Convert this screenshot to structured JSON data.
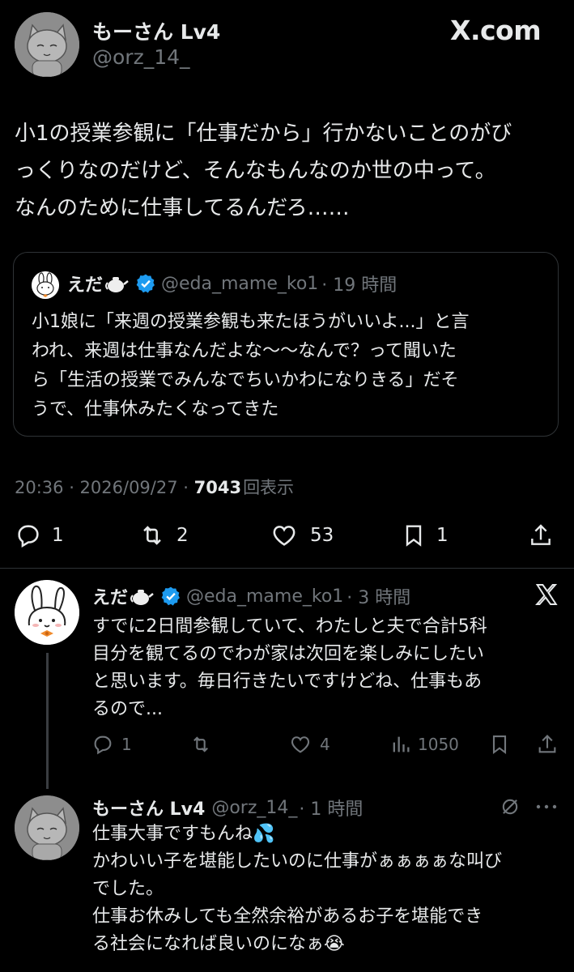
{
  "brand": {
    "logo_text": "X.com"
  },
  "main_tweet": {
    "display_name": "もーさん Lv4",
    "handle": "@orz_14_",
    "body_lines": [
      "小1の授業参観に「仕事だから」行かないことのがび",
      "っくりなのだけど、そんなもんなのか世の中って。",
      "なんのために仕事してるんだろ……"
    ],
    "timestamp": "20:36 · 2026/09/27 · ",
    "views_count": "7043",
    "views_label": "回表示",
    "actions": {
      "replies": "1",
      "retweets": "2",
      "likes": "53",
      "bookmarks": "1"
    }
  },
  "quoted_tweet": {
    "display_name": "えだ",
    "handle": "@eda_mame_ko1",
    "time": "· 19 時間",
    "body_lines": [
      "小1娘に「来週の授業参観も来たほうがいいよ...」と言",
      "われ、来週は仕事なんだよな〜〜なんで？って聞いた",
      "ら「生活の授業でみんなでちいかわになりきる」だそ",
      "うで、仕事休みたくなってきた"
    ]
  },
  "reply_1": {
    "display_name": "えだ",
    "handle": "@eda_mame_ko1",
    "time": "· 3 時間",
    "body_lines": [
      "すでに2日間参観していて、わたしと夫で合計5科",
      "目分を観てるのでわが家は次回を楽しみにしたい",
      "と思います。毎日行きたいですけどね、仕事もあ",
      "るので..."
    ],
    "actions": {
      "replies": "1",
      "retweets": "",
      "likes": "4",
      "views": "1050"
    }
  },
  "reply_2": {
    "display_name": "もーさん Lv4",
    "handle": "@orz_14_",
    "time": "· 1 時間",
    "body_lines": [
      "仕事大事ですもんね💦",
      "かわいい子を堪能したいのに仕事がぁぁぁぁな叫び",
      "でした。",
      "仕事お休みしても全然余裕があるお子を堪能でき",
      "る社会になれば良いのになぁ😭"
    ]
  },
  "colors": {
    "background": "#000000",
    "text": "#e7e9ea",
    "secondary": "#71767b",
    "verified": "#1d9bf0",
    "border": "#2f3336"
  }
}
